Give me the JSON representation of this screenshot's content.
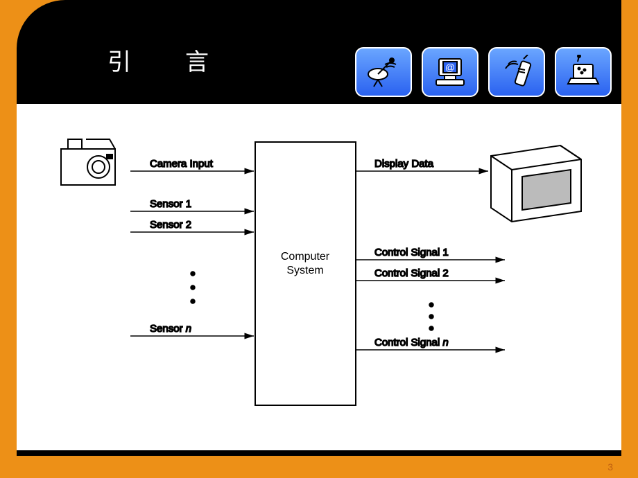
{
  "slide": {
    "title": "引　言",
    "page_number": "3"
  },
  "diagram": {
    "center_label_line1": "Computer",
    "center_label_line2": "System",
    "inputs": {
      "camera": "Camera Input",
      "sensor1": "Sensor 1",
      "sensor2": "Sensor 2",
      "sensorN": "Sensor n"
    },
    "outputs": {
      "display": "Display Data",
      "control1": "Control Signal 1",
      "control2": "Control Signal 2",
      "controlN": "Control Signal n"
    }
  },
  "icons": {
    "i1": "satellite-dish-icon",
    "i2": "computer-at-icon",
    "i3": "mobile-phone-icon",
    "i4": "laptop-signal-icon"
  }
}
